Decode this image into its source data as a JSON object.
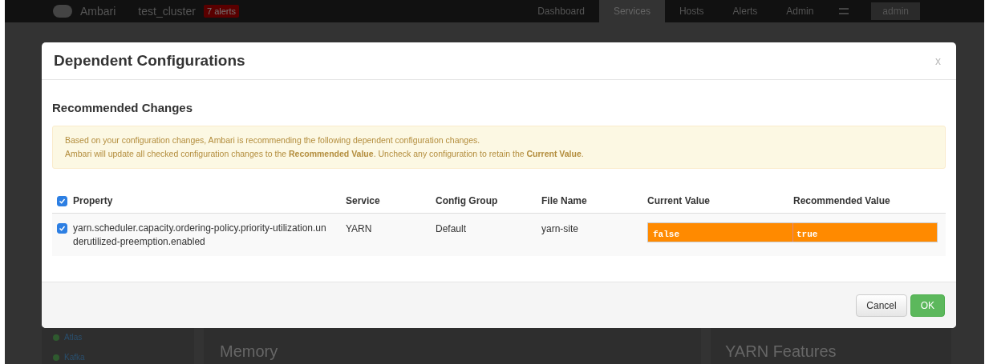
{
  "navbar": {
    "brand": "Ambari",
    "cluster": "test_cluster",
    "alerts_badge": "7 alerts",
    "menu": [
      {
        "label": "Dashboard",
        "selected": false
      },
      {
        "label": "Services",
        "selected": true
      },
      {
        "label": "Hosts",
        "selected": false
      },
      {
        "label": "Alerts",
        "selected": false
      },
      {
        "label": "Admin",
        "selected": false
      }
    ],
    "user": "admin"
  },
  "background": {
    "sidebar": [
      "Atlas",
      "Kafka"
    ],
    "panels": [
      "Memory",
      "YARN Features"
    ]
  },
  "dialog": {
    "title": "Dependent Configurations",
    "close": "x",
    "section_title": "Recommended Changes",
    "notice": [
      "Based on your configuration changes, Ambari is recommending the following dependent configuration changes.",
      "Ambari will update all checked configuration changes to the **Recommended Value**. Uncheck any configuration to retain the **Current Value**."
    ],
    "table": {
      "all_checked": true,
      "columns": [
        "Property",
        "Service",
        "Config Group",
        "File Name",
        "Current Value",
        "Recommended Value"
      ],
      "rows": [
        {
          "checked": true,
          "property": "yarn.scheduler.capacity.ordering-policy.priority-utilization.underutilized-preemption.enabled",
          "service": "YARN",
          "config_group": "Default",
          "file_name": "yarn-site",
          "current_value": "false",
          "recommended_value": "true"
        }
      ]
    },
    "buttons": [
      {
        "label": "Cancel",
        "kind": "default"
      },
      {
        "label": "OK",
        "kind": "primary"
      }
    ]
  }
}
